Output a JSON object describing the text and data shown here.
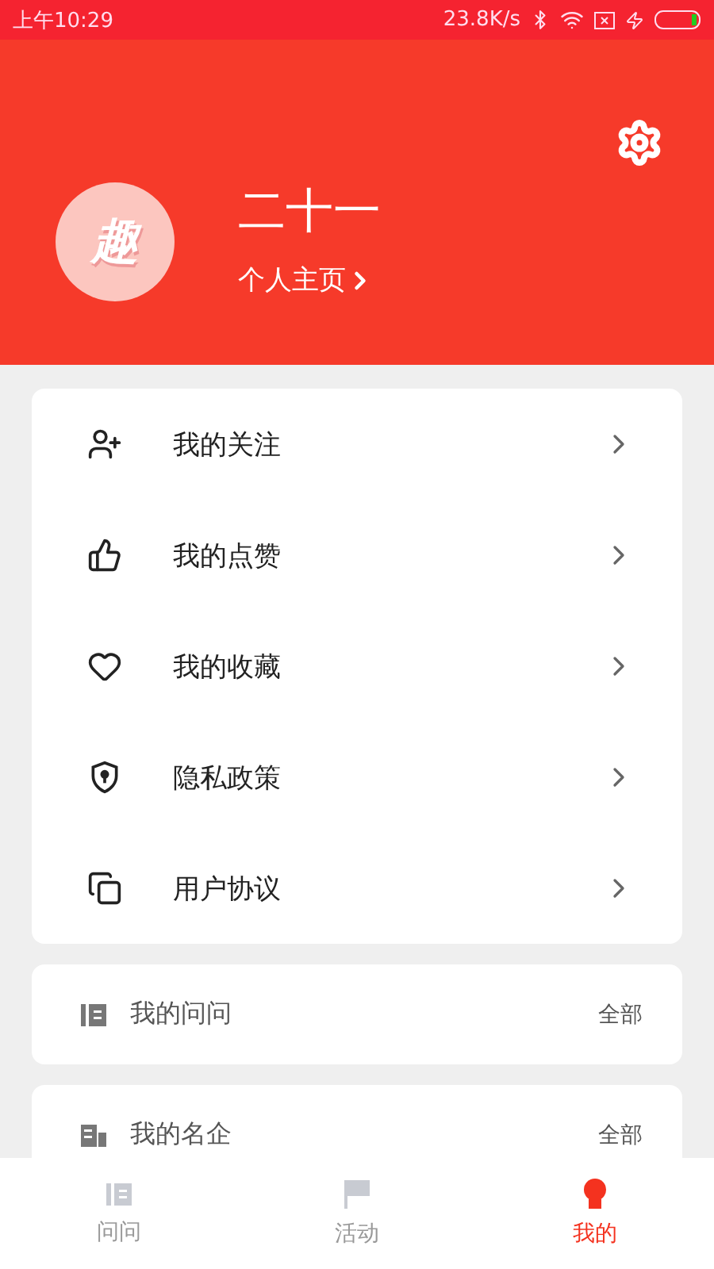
{
  "status_bar": {
    "time": "上午10:29",
    "speed": "23.8K/s"
  },
  "profile": {
    "avatar_text": "趣",
    "name": "二十一",
    "homepage_link": "个人主页"
  },
  "menu": [
    {
      "kind": "follow",
      "label": "我的关注"
    },
    {
      "kind": "like",
      "label": "我的点赞"
    },
    {
      "kind": "favorite",
      "label": "我的收藏"
    },
    {
      "kind": "privacy",
      "label": "隐私政策"
    },
    {
      "kind": "agreement",
      "label": "用户协议"
    }
  ],
  "sections": [
    {
      "kind": "questions",
      "title": "我的问问",
      "action": "全部"
    },
    {
      "kind": "companies",
      "title": "我的名企",
      "action": "全部"
    }
  ],
  "tabs": [
    {
      "kind": "questions",
      "label": "问问",
      "selected": false
    },
    {
      "kind": "events",
      "label": "活动",
      "selected": false
    },
    {
      "kind": "me",
      "label": "我的",
      "selected": true
    }
  ]
}
